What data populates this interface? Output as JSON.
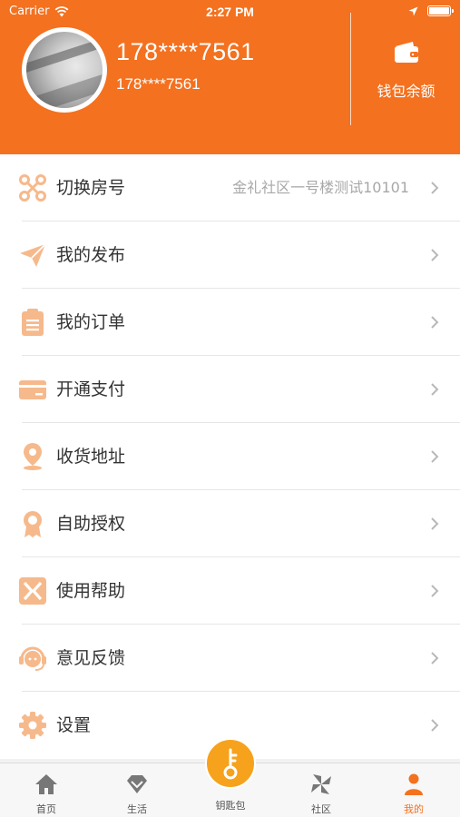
{
  "status_bar": {
    "carrier": "Carrier",
    "time": "2:27 PM"
  },
  "profile": {
    "phone_main": "178****7561",
    "phone_sub": "178****7561",
    "wallet_label": "钱包余额"
  },
  "menu": [
    {
      "label": "切换房号",
      "value": "金礼社区一号楼测试10101",
      "icon": "switch-room-icon"
    },
    {
      "label": "我的发布",
      "value": "",
      "icon": "paper-plane-icon"
    },
    {
      "label": "我的订单",
      "value": "",
      "icon": "clipboard-icon"
    },
    {
      "label": "开通支付",
      "value": "",
      "icon": "credit-card-icon"
    },
    {
      "label": "收货地址",
      "value": "",
      "icon": "location-pin-icon"
    },
    {
      "label": "自助授权",
      "value": "",
      "icon": "badge-icon"
    },
    {
      "label": "使用帮助",
      "value": "",
      "icon": "help-icon"
    },
    {
      "label": "意见反馈",
      "value": "",
      "icon": "headset-icon"
    },
    {
      "label": "设置",
      "value": "",
      "icon": "gear-icon"
    }
  ],
  "tabs": [
    {
      "label": "首页",
      "icon": "home-icon"
    },
    {
      "label": "生活",
      "icon": "diamond-icon"
    },
    {
      "label": "钥匙包",
      "icon": "key-icon"
    },
    {
      "label": "社区",
      "icon": "pinwheel-icon"
    },
    {
      "label": "我的",
      "icon": "person-icon"
    }
  ],
  "colors": {
    "brand": "#f4711f",
    "icon": "#f6b98c",
    "key_button": "#f7a21c"
  }
}
